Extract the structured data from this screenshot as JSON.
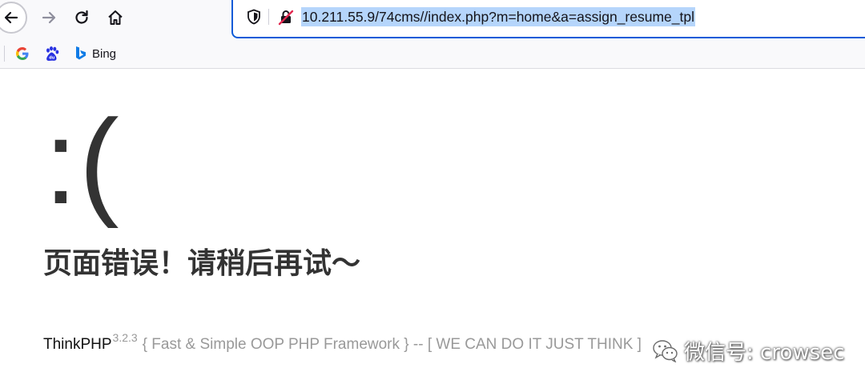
{
  "browser": {
    "url": "10.211.55.9/74cms//index.php?m=home&a=assign_resume_tpl",
    "bookmarks": [
      {
        "label": "",
        "icon": "google-icon"
      },
      {
        "label": "",
        "icon": "baidu-icon"
      },
      {
        "label": "Bing",
        "icon": "bing-icon"
      }
    ],
    "accent_color": "#0a5bd8"
  },
  "page": {
    "face": ":(",
    "message": "页面错误！请稍后再试～",
    "footer": {
      "brand": "ThinkPHP",
      "version": "3.2.3",
      "slogan": "{ Fast & Simple OOP PHP Framework } -- [ WE CAN DO IT JUST THINK ]"
    }
  },
  "watermark": {
    "text": "微信号: crowsec"
  }
}
